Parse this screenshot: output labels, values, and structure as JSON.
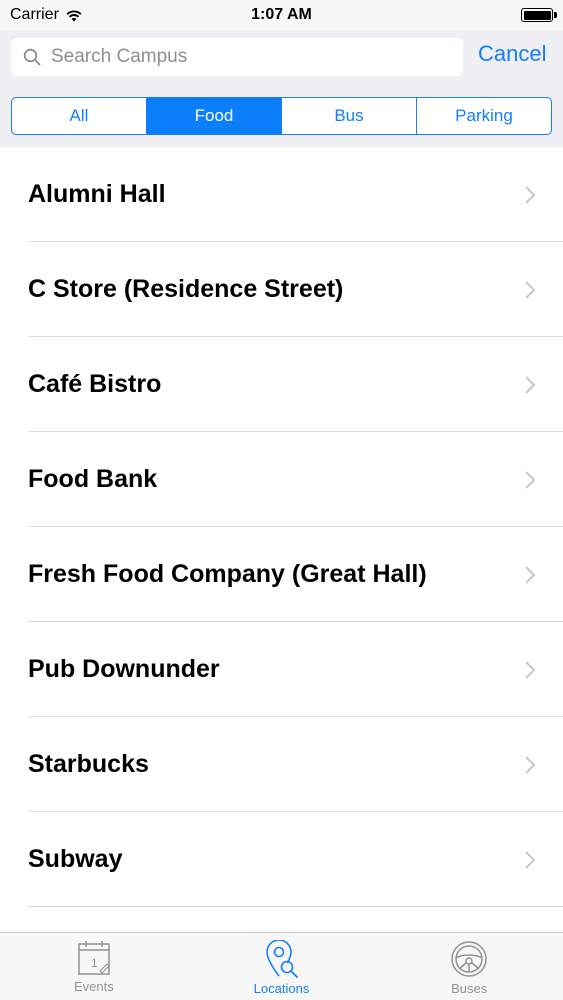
{
  "status_bar": {
    "carrier": "Carrier",
    "time": "1:07 AM"
  },
  "search": {
    "placeholder": "Search Campus",
    "value": "",
    "cancel_label": "Cancel"
  },
  "segments": [
    {
      "label": "All",
      "selected": false
    },
    {
      "label": "Food",
      "selected": true
    },
    {
      "label": "Bus",
      "selected": false
    },
    {
      "label": "Parking",
      "selected": false
    }
  ],
  "locations": [
    {
      "label": "Alumni Hall"
    },
    {
      "label": "C Store (Residence Street)"
    },
    {
      "label": "Café Bistro"
    },
    {
      "label": "Food Bank"
    },
    {
      "label": "Fresh Food Company (Great Hall)"
    },
    {
      "label": "Pub Downunder"
    },
    {
      "label": "Starbucks"
    },
    {
      "label": "Subway"
    }
  ],
  "tab_bar": {
    "tabs": [
      {
        "label": "Events",
        "icon": "calendar-icon",
        "selected": false
      },
      {
        "label": "Locations",
        "icon": "map-pin-search-icon",
        "selected": true
      },
      {
        "label": "Buses",
        "icon": "steering-wheel-icon",
        "selected": false
      }
    ]
  },
  "colors": {
    "accent": "#147efb",
    "header_bg": "#efeff4",
    "separator": "#dedee2",
    "inactive_tab": "#929292"
  }
}
